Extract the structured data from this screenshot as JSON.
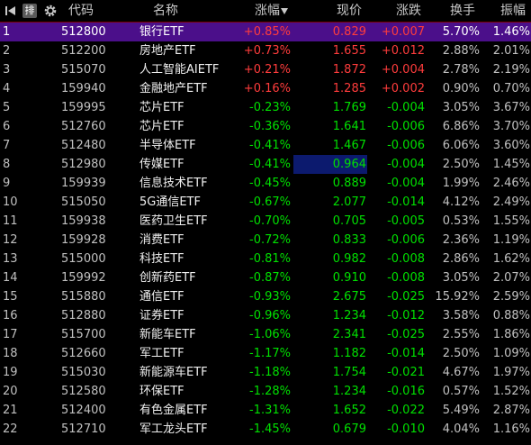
{
  "header": {
    "col_code": "代码",
    "col_name": "名称",
    "col_pct": "涨幅",
    "col_price": "现价",
    "col_change": "涨跌",
    "col_turnover": "换手",
    "col_amplitude": "振幅",
    "sort_button_label": "排"
  },
  "rows": [
    {
      "idx": "1",
      "code": "512800",
      "name": "银行ETF",
      "pct": "+0.85%",
      "price": "0.829",
      "chg": "+0.007",
      "turn": "5.70%",
      "amp": "1.46%",
      "dir": "up"
    },
    {
      "idx": "2",
      "code": "512200",
      "name": "房地产ETF",
      "pct": "+0.73%",
      "price": "1.655",
      "chg": "+0.012",
      "turn": "2.88%",
      "amp": "2.01%",
      "dir": "up"
    },
    {
      "idx": "3",
      "code": "515070",
      "name": "人工智能AIETF",
      "pct": "+0.21%",
      "price": "1.872",
      "chg": "+0.004",
      "turn": "2.78%",
      "amp": "2.19%",
      "dir": "up"
    },
    {
      "idx": "4",
      "code": "159940",
      "name": "金融地产ETF",
      "pct": "+0.16%",
      "price": "1.285",
      "chg": "+0.002",
      "turn": "0.90%",
      "amp": "0.70%",
      "dir": "up"
    },
    {
      "idx": "5",
      "code": "159995",
      "name": "芯片ETF",
      "pct": "-0.23%",
      "price": "1.769",
      "chg": "-0.004",
      "turn": "3.05%",
      "amp": "3.67%",
      "dir": "down"
    },
    {
      "idx": "6",
      "code": "512760",
      "name": "芯片ETF",
      "pct": "-0.36%",
      "price": "1.641",
      "chg": "-0.006",
      "turn": "6.86%",
      "amp": "3.70%",
      "dir": "down"
    },
    {
      "idx": "7",
      "code": "512480",
      "name": "半导体ETF",
      "pct": "-0.41%",
      "price": "1.467",
      "chg": "-0.006",
      "turn": "6.06%",
      "amp": "3.60%",
      "dir": "down"
    },
    {
      "idx": "8",
      "code": "512980",
      "name": "传媒ETF",
      "pct": "-0.41%",
      "price": "0.964",
      "chg": "-0.004",
      "turn": "2.50%",
      "amp": "1.45%",
      "dir": "down",
      "hl": true
    },
    {
      "idx": "9",
      "code": "159939",
      "name": "信息技术ETF",
      "pct": "-0.45%",
      "price": "0.889",
      "chg": "-0.004",
      "turn": "1.99%",
      "amp": "2.46%",
      "dir": "down"
    },
    {
      "idx": "10",
      "code": "515050",
      "name": "5G通信ETF",
      "pct": "-0.67%",
      "price": "2.077",
      "chg": "-0.014",
      "turn": "4.12%",
      "amp": "2.49%",
      "dir": "down"
    },
    {
      "idx": "11",
      "code": "159938",
      "name": "医药卫生ETF",
      "pct": "-0.70%",
      "price": "0.705",
      "chg": "-0.005",
      "turn": "0.53%",
      "amp": "1.55%",
      "dir": "down"
    },
    {
      "idx": "12",
      "code": "159928",
      "name": "消费ETF",
      "pct": "-0.72%",
      "price": "0.833",
      "chg": "-0.006",
      "turn": "2.36%",
      "amp": "1.19%",
      "dir": "down"
    },
    {
      "idx": "13",
      "code": "515000",
      "name": "科技ETF",
      "pct": "-0.81%",
      "price": "0.982",
      "chg": "-0.008",
      "turn": "2.86%",
      "amp": "1.62%",
      "dir": "down"
    },
    {
      "idx": "14",
      "code": "159992",
      "name": "创新药ETF",
      "pct": "-0.87%",
      "price": "0.910",
      "chg": "-0.008",
      "turn": "3.05%",
      "amp": "2.07%",
      "dir": "down"
    },
    {
      "idx": "15",
      "code": "515880",
      "name": "通信ETF",
      "pct": "-0.93%",
      "price": "2.675",
      "chg": "-0.025",
      "turn": "15.92%",
      "amp": "2.59%",
      "dir": "down"
    },
    {
      "idx": "16",
      "code": "512880",
      "name": "证券ETF",
      "pct": "-0.96%",
      "price": "1.234",
      "chg": "-0.012",
      "turn": "3.58%",
      "amp": "0.88%",
      "dir": "down"
    },
    {
      "idx": "17",
      "code": "515700",
      "name": "新能车ETF",
      "pct": "-1.06%",
      "price": "2.341",
      "chg": "-0.025",
      "turn": "2.55%",
      "amp": "1.86%",
      "dir": "down"
    },
    {
      "idx": "18",
      "code": "512660",
      "name": "军工ETF",
      "pct": "-1.17%",
      "price": "1.182",
      "chg": "-0.014",
      "turn": "2.50%",
      "amp": "1.09%",
      "dir": "down"
    },
    {
      "idx": "19",
      "code": "515030",
      "name": "新能源车ETF",
      "pct": "-1.18%",
      "price": "1.754",
      "chg": "-0.021",
      "turn": "4.67%",
      "amp": "1.97%",
      "dir": "down"
    },
    {
      "idx": "20",
      "code": "512580",
      "name": "环保ETF",
      "pct": "-1.28%",
      "price": "1.234",
      "chg": "-0.016",
      "turn": "0.57%",
      "amp": "1.52%",
      "dir": "down"
    },
    {
      "idx": "21",
      "code": "512400",
      "name": "有色金属ETF",
      "pct": "-1.31%",
      "price": "1.652",
      "chg": "-0.022",
      "turn": "5.49%",
      "amp": "2.87%",
      "dir": "down"
    },
    {
      "idx": "22",
      "code": "512710",
      "name": "军工龙头ETF",
      "pct": "-1.45%",
      "price": "0.679",
      "chg": "-0.010",
      "turn": "4.04%",
      "amp": "1.16%",
      "dir": "down"
    }
  ],
  "selected_row_index": 0,
  "colors": {
    "up": "#ff3c3c",
    "down": "#00e000",
    "selected": "#4b0f8a",
    "highlight": "#0c1a6e",
    "header_border": "#7a0000"
  },
  "icons": [
    "first-page-icon",
    "sort-button",
    "settings-gear-icon",
    "sort-desc-icon"
  ]
}
